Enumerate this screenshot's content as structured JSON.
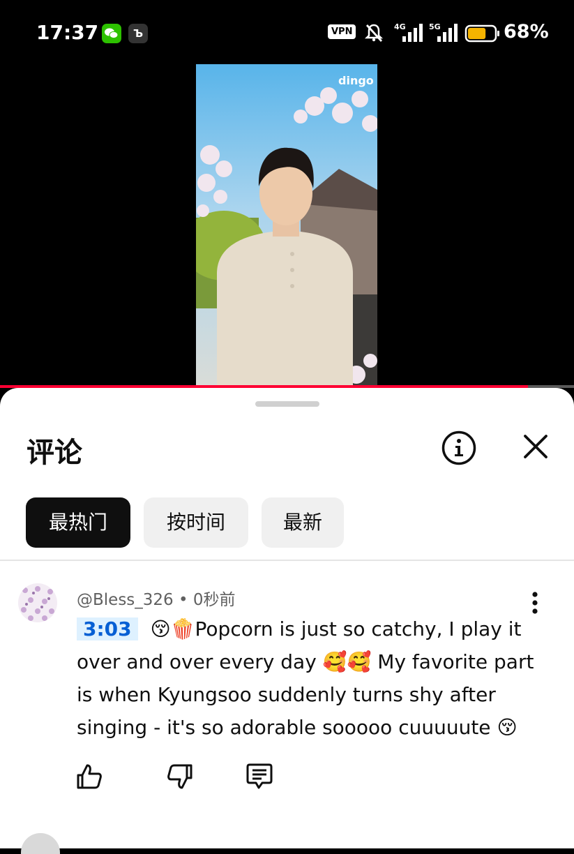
{
  "status_bar": {
    "time": "17:37",
    "vpn_label": "VPN",
    "net1_label": "4G",
    "net2_label": "5G",
    "battery_percent": "68%",
    "battery_level": 0.68,
    "battery_color": "#f5b400"
  },
  "video": {
    "watermark": "dingo",
    "progress": 0.92,
    "progress_color": "#ff0033"
  },
  "comments_panel": {
    "title": "评论",
    "filters": [
      {
        "label": "最热门",
        "active": true
      },
      {
        "label": "按时间",
        "active": false
      },
      {
        "label": "最新",
        "active": false
      }
    ]
  },
  "comment": {
    "author": "@Bless_326",
    "separator": "•",
    "time_ago": "0秒前",
    "timestamp_link": "3:03",
    "text": "😚🍿Popcorn is just so catchy, I play it over and over every day 🥰🥰 My favorite part is when Kyungsoo suddenly turns shy after singing - it's so adorable sooooo cuuuuute 😚"
  },
  "colors": {
    "link_blue": "#065fd4",
    "chip_active_bg": "#0f0f0f",
    "chip_idle_bg": "#f0f0f0"
  }
}
